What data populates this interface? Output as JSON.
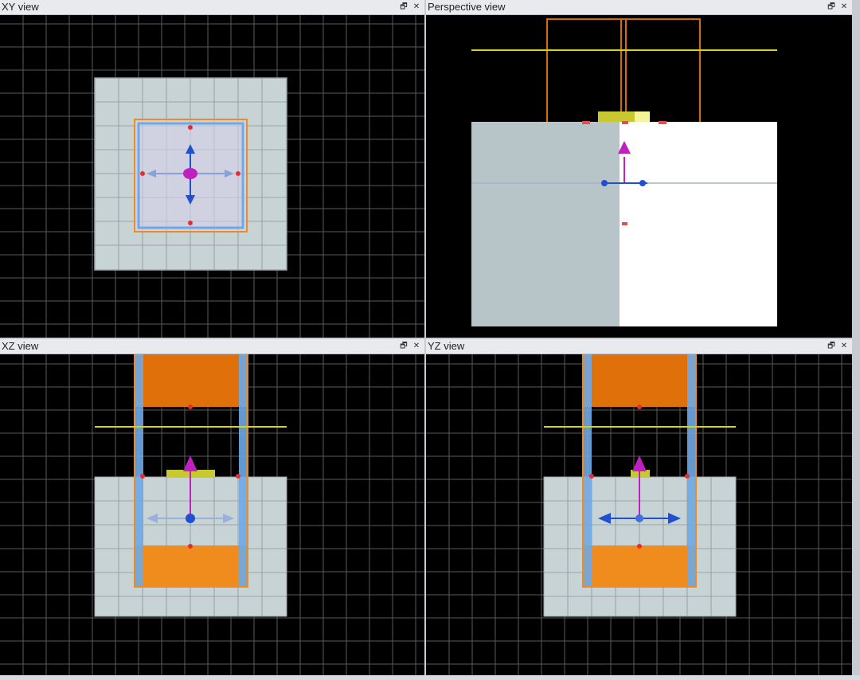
{
  "views": {
    "xy": {
      "title": "XY view"
    },
    "perspective": {
      "title": "Perspective view"
    },
    "xz": {
      "title": "XZ view"
    },
    "yz": {
      "title": "YZ view"
    }
  },
  "window_controls": {
    "restore_icon": "restore-icon",
    "close_icon": "close-icon",
    "restore_glyph": "🗗",
    "close_glyph": "✕"
  },
  "colors": {
    "background": "#000000",
    "grid": "#5a5a5a",
    "substrate": "#c7d3d5",
    "orange": "#f08c1e",
    "orange_dark": "#d86a08",
    "blue_outline": "#6fa8e6",
    "yellow": "#d8d800",
    "magenta": "#c020c0",
    "gizmo_blue": "#2050d0",
    "red_marker": "#e03030"
  }
}
